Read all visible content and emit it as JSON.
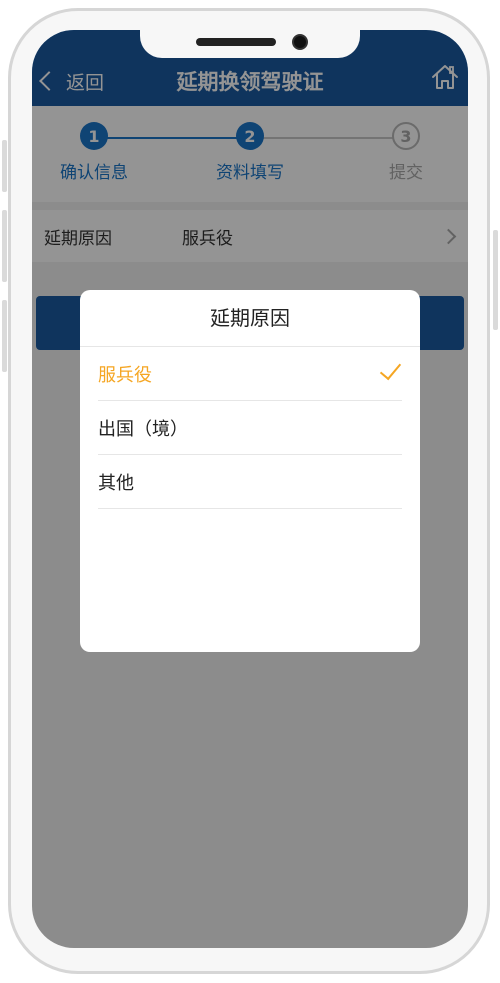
{
  "nav": {
    "back_label": "返回",
    "title": "延期换领驾驶证"
  },
  "steps": [
    {
      "number": "1",
      "label": "确认信息",
      "state": "done"
    },
    {
      "number": "2",
      "label": "资料填写",
      "state": "active"
    },
    {
      "number": "3",
      "label": "提交",
      "state": "pending"
    }
  ],
  "form": {
    "reason_label": "延期原因",
    "reason_value": "服兵役"
  },
  "picker": {
    "title": "延期原因",
    "options": [
      {
        "label": "服兵役",
        "selected": true
      },
      {
        "label": "出国（境）",
        "selected": false
      },
      {
        "label": "其他",
        "selected": false
      }
    ]
  },
  "colors": {
    "nav": "#1a5aa0",
    "step_active": "#1a75c9",
    "selected": "#f5a623"
  },
  "icons": [
    "chevron-left-icon",
    "home-icon",
    "chevron-right-icon",
    "checkmark-icon"
  ]
}
